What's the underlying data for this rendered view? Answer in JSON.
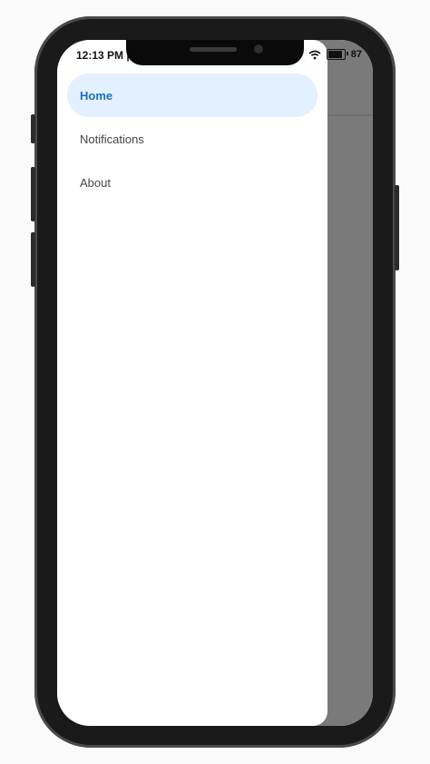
{
  "status_bar": {
    "time": "12:13 PM |",
    "battery": "87"
  },
  "drawer": {
    "items": [
      {
        "label": "Home",
        "active": true
      },
      {
        "label": "Notifications",
        "active": false
      },
      {
        "label": "About",
        "active": false
      }
    ]
  },
  "colors": {
    "active_bg": "#e3f0ff",
    "active_text": "#1a6fc2",
    "scrim": "#7a7a7a"
  }
}
